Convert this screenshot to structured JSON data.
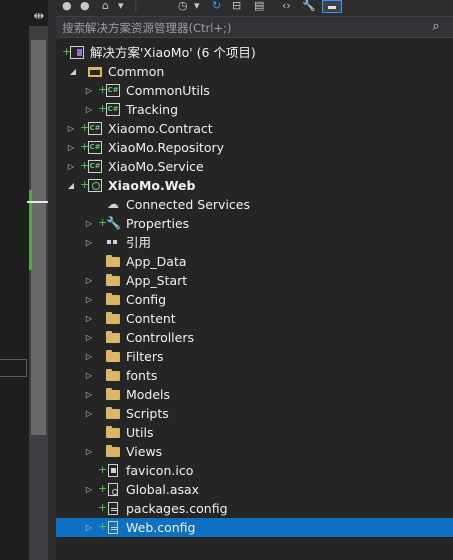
{
  "toolbar": {
    "icons": [
      "back-icon",
      "forward-icon",
      "home-icon",
      "dropdown-icon",
      "history-icon",
      "refresh-icon",
      "collapse-icon",
      "properties-icon",
      "code-icon",
      "wrench-icon",
      "active-view-icon"
    ]
  },
  "search": {
    "placeholder": "搜索解决方案资源管理器(Ctrl+;)",
    "icon": "search-icon"
  },
  "tree": {
    "solution_label": "解决方案'XiaoMo' (6 个项目)",
    "items": [
      {
        "label": "Common"
      },
      {
        "label": "CommonUtils"
      },
      {
        "label": "Tracking"
      },
      {
        "label": "Xiaomo.Contract"
      },
      {
        "label": "XiaoMo.Repository"
      },
      {
        "label": "XiaoMo.Service"
      },
      {
        "label": "XiaoMo.Web"
      },
      {
        "label": "Connected Services"
      },
      {
        "label": "Properties"
      },
      {
        "label": "引用"
      },
      {
        "label": "App_Data"
      },
      {
        "label": "App_Start"
      },
      {
        "label": "Config"
      },
      {
        "label": "Content"
      },
      {
        "label": "Controllers"
      },
      {
        "label": "Filters"
      },
      {
        "label": "fonts"
      },
      {
        "label": "Models"
      },
      {
        "label": "Scripts"
      },
      {
        "label": "Utils"
      },
      {
        "label": "Views"
      },
      {
        "label": "favicon.ico"
      },
      {
        "label": "Global.asax"
      },
      {
        "label": "packages.config"
      },
      {
        "label": "Web.config"
      }
    ],
    "selected_item": "Web.config"
  },
  "colors": {
    "background": "#252526",
    "selection": "#0e70c0",
    "folder": "#dcb567",
    "git_added": "#4ec94e"
  }
}
